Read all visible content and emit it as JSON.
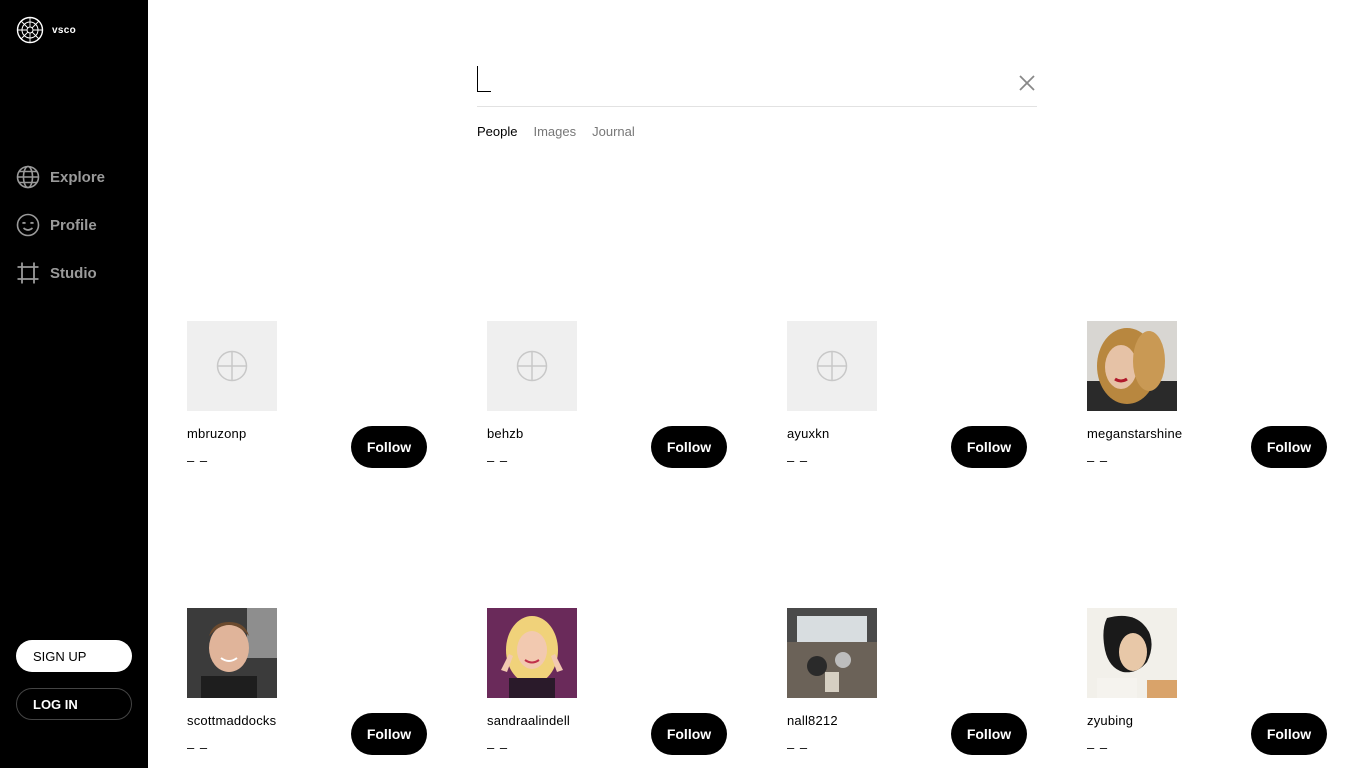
{
  "brand": {
    "name": "vsco"
  },
  "nav": [
    {
      "label": "Explore",
      "icon": "globe-icon"
    },
    {
      "label": "Profile",
      "icon": "smiley-face-icon"
    },
    {
      "label": "Studio",
      "icon": "crop-frame-icon"
    }
  ],
  "auth": {
    "signup_label": "SIGN UP",
    "login_label": "LOG IN"
  },
  "search": {
    "value": "",
    "placeholder": ""
  },
  "tabs": [
    {
      "label": "People",
      "active": true
    },
    {
      "label": "Images",
      "active": false
    },
    {
      "label": "Journal",
      "active": false
    }
  ],
  "results": [
    {
      "username": "mbruzonp",
      "subtitle": "– –",
      "follow_label": "Follow",
      "avatar": "placeholder"
    },
    {
      "username": "behzb",
      "subtitle": "– –",
      "follow_label": "Follow",
      "avatar": "placeholder"
    },
    {
      "username": "ayuxkn",
      "subtitle": "– –",
      "follow_label": "Follow",
      "avatar": "placeholder"
    },
    {
      "username": "meganstarshine",
      "subtitle": "– –",
      "follow_label": "Follow",
      "avatar": "photo"
    },
    {
      "username": "scottmaddocks",
      "subtitle": "– –",
      "follow_label": "Follow",
      "avatar": "photo"
    },
    {
      "username": "sandraalindell",
      "subtitle": "– –",
      "follow_label": "Follow",
      "avatar": "photo"
    },
    {
      "username": "nall8212",
      "subtitle": "– –",
      "follow_label": "Follow",
      "avatar": "photo"
    },
    {
      "username": "zyubing",
      "subtitle": "– –",
      "follow_label": "Follow",
      "avatar": "photo"
    }
  ],
  "colors": {
    "sidebar_bg": "#000000",
    "nav_text": "#9a9a9a",
    "button_bg": "#000000",
    "placeholder_bg": "#efefef"
  }
}
